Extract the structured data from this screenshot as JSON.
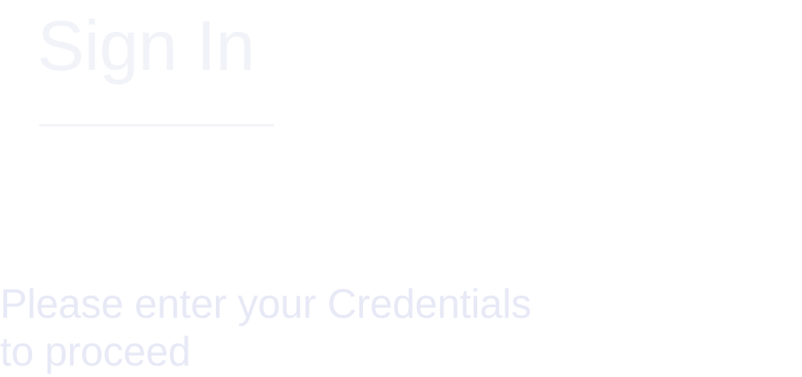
{
  "header": {
    "title": "Sign In"
  },
  "intro": {
    "line1": "Please enter your Credentials",
    "line2": "to proceed"
  },
  "colors": {
    "title": "#f2f3f9",
    "divider": "#f4f4f8",
    "subtitle": "#e7e9f6",
    "background": "#ffffff"
  }
}
